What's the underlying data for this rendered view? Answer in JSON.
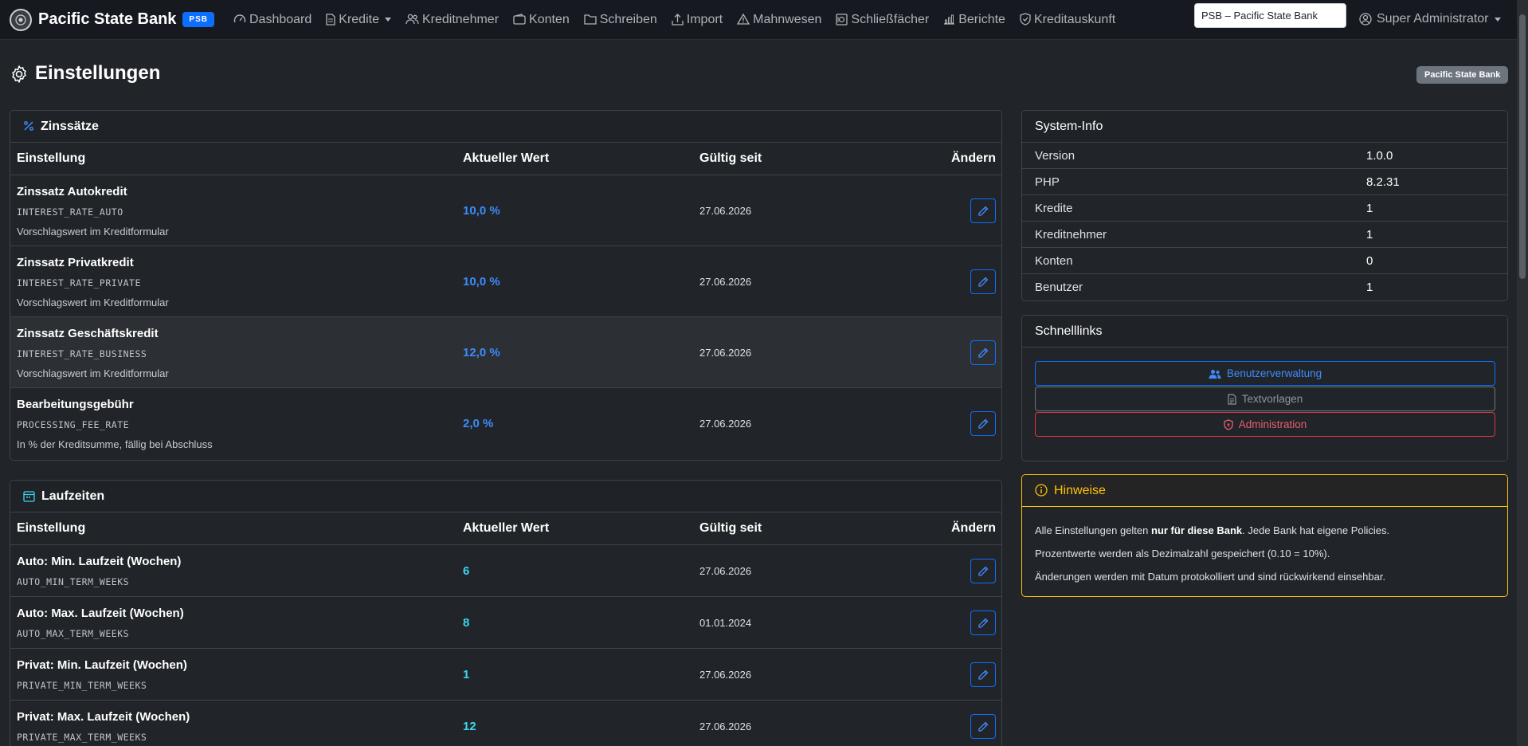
{
  "nav": {
    "brand": "Pacific State Bank",
    "brand_badge": "PSB",
    "items": [
      {
        "label": "Dashboard",
        "icon": "speedometer-icon"
      },
      {
        "label": "Kredite",
        "icon": "document-icon",
        "dropdown": true
      },
      {
        "label": "Kreditnehmer",
        "icon": "people-icon"
      },
      {
        "label": "Konten",
        "icon": "wallet-icon"
      },
      {
        "label": "Schreiben",
        "icon": "folder-icon"
      },
      {
        "label": "Import",
        "icon": "upload-icon"
      },
      {
        "label": "Mahnwesen",
        "icon": "warning-icon"
      },
      {
        "label": "Schließfächer",
        "icon": "safe-icon"
      },
      {
        "label": "Berichte",
        "icon": "bar-chart-icon"
      },
      {
        "label": "Kreditauskunft",
        "icon": "shield-check-icon"
      }
    ],
    "bank_select": "PSB – Pacific State Bank",
    "user": "Super Administrator"
  },
  "page": {
    "title": "Einstellungen",
    "bank_badge": "Pacific State Bank"
  },
  "interest": {
    "title": "Zinssätze",
    "headers": {
      "setting": "Einstellung",
      "value": "Aktueller Wert",
      "since": "Gültig seit",
      "edit": "Ändern"
    },
    "rows": [
      {
        "name": "Zinssatz Autokredit",
        "key": "INTEREST_RATE_AUTO",
        "desc": "Vorschlagswert im Kreditformular",
        "value": "10,0 %",
        "date": "27.06.2026"
      },
      {
        "name": "Zinssatz Privatkredit",
        "key": "INTEREST_RATE_PRIVATE",
        "desc": "Vorschlagswert im Kreditformular",
        "value": "10,0 %",
        "date": "27.06.2026"
      },
      {
        "name": "Zinssatz Geschäftskredit",
        "key": "INTEREST_RATE_BUSINESS",
        "desc": "Vorschlagswert im Kreditformular",
        "value": "12,0 %",
        "date": "27.06.2026"
      },
      {
        "name": "Bearbeitungsgebühr",
        "key": "PROCESSING_FEE_RATE",
        "desc": "In % der Kreditsumme, fällig bei Abschluss",
        "value": "2,0 %",
        "date": "27.06.2026"
      }
    ]
  },
  "terms": {
    "title": "Laufzeiten",
    "headers": {
      "setting": "Einstellung",
      "value": "Aktueller Wert",
      "since": "Gültig seit",
      "edit": "Ändern"
    },
    "rows": [
      {
        "name": "Auto: Min. Laufzeit (Wochen)",
        "key": "AUTO_MIN_TERM_WEEKS",
        "value": "6",
        "date": "27.06.2026"
      },
      {
        "name": "Auto: Max. Laufzeit (Wochen)",
        "key": "AUTO_MAX_TERM_WEEKS",
        "value": "8",
        "date": "01.01.2024"
      },
      {
        "name": "Privat: Min. Laufzeit (Wochen)",
        "key": "PRIVATE_MIN_TERM_WEEKS",
        "value": "1",
        "date": "27.06.2026"
      },
      {
        "name": "Privat: Max. Laufzeit (Wochen)",
        "key": "PRIVATE_MAX_TERM_WEEKS",
        "value": "12",
        "date": "27.06.2026"
      }
    ]
  },
  "sysinfo": {
    "title": "System-Info",
    "rows": [
      {
        "k": "Version",
        "v": "1.0.0"
      },
      {
        "k": "PHP",
        "v": "8.2.31"
      },
      {
        "k": "Kredite",
        "v": "1"
      },
      {
        "k": "Kreditnehmer",
        "v": "1"
      },
      {
        "k": "Konten",
        "v": "0"
      },
      {
        "k": "Benutzer",
        "v": "1"
      }
    ]
  },
  "quicklinks": {
    "title": "Schnelllinks",
    "users": "Benutzerverwaltung",
    "templates": "Textvorlagen",
    "admin": "Administration"
  },
  "notes": {
    "title": "Hinweise",
    "line1_pre": "Alle Einstellungen gelten ",
    "line1_bold": "nur für diese Bank",
    "line1_post": ". Jede Bank hat eigene Policies.",
    "line2": "Prozentwerte werden als Dezimalzahl gespeichert (0.10 = 10%).",
    "line3": "Änderungen werden mit Datum protokolliert und sind rückwirkend einsehbar."
  },
  "colors": {
    "accent": "#0d6efd",
    "value_blue": "#3d8bfd",
    "value_cyan": "#3dd5f3",
    "danger": "#dc3545",
    "warning": "#ffc107",
    "background": "#212529"
  }
}
